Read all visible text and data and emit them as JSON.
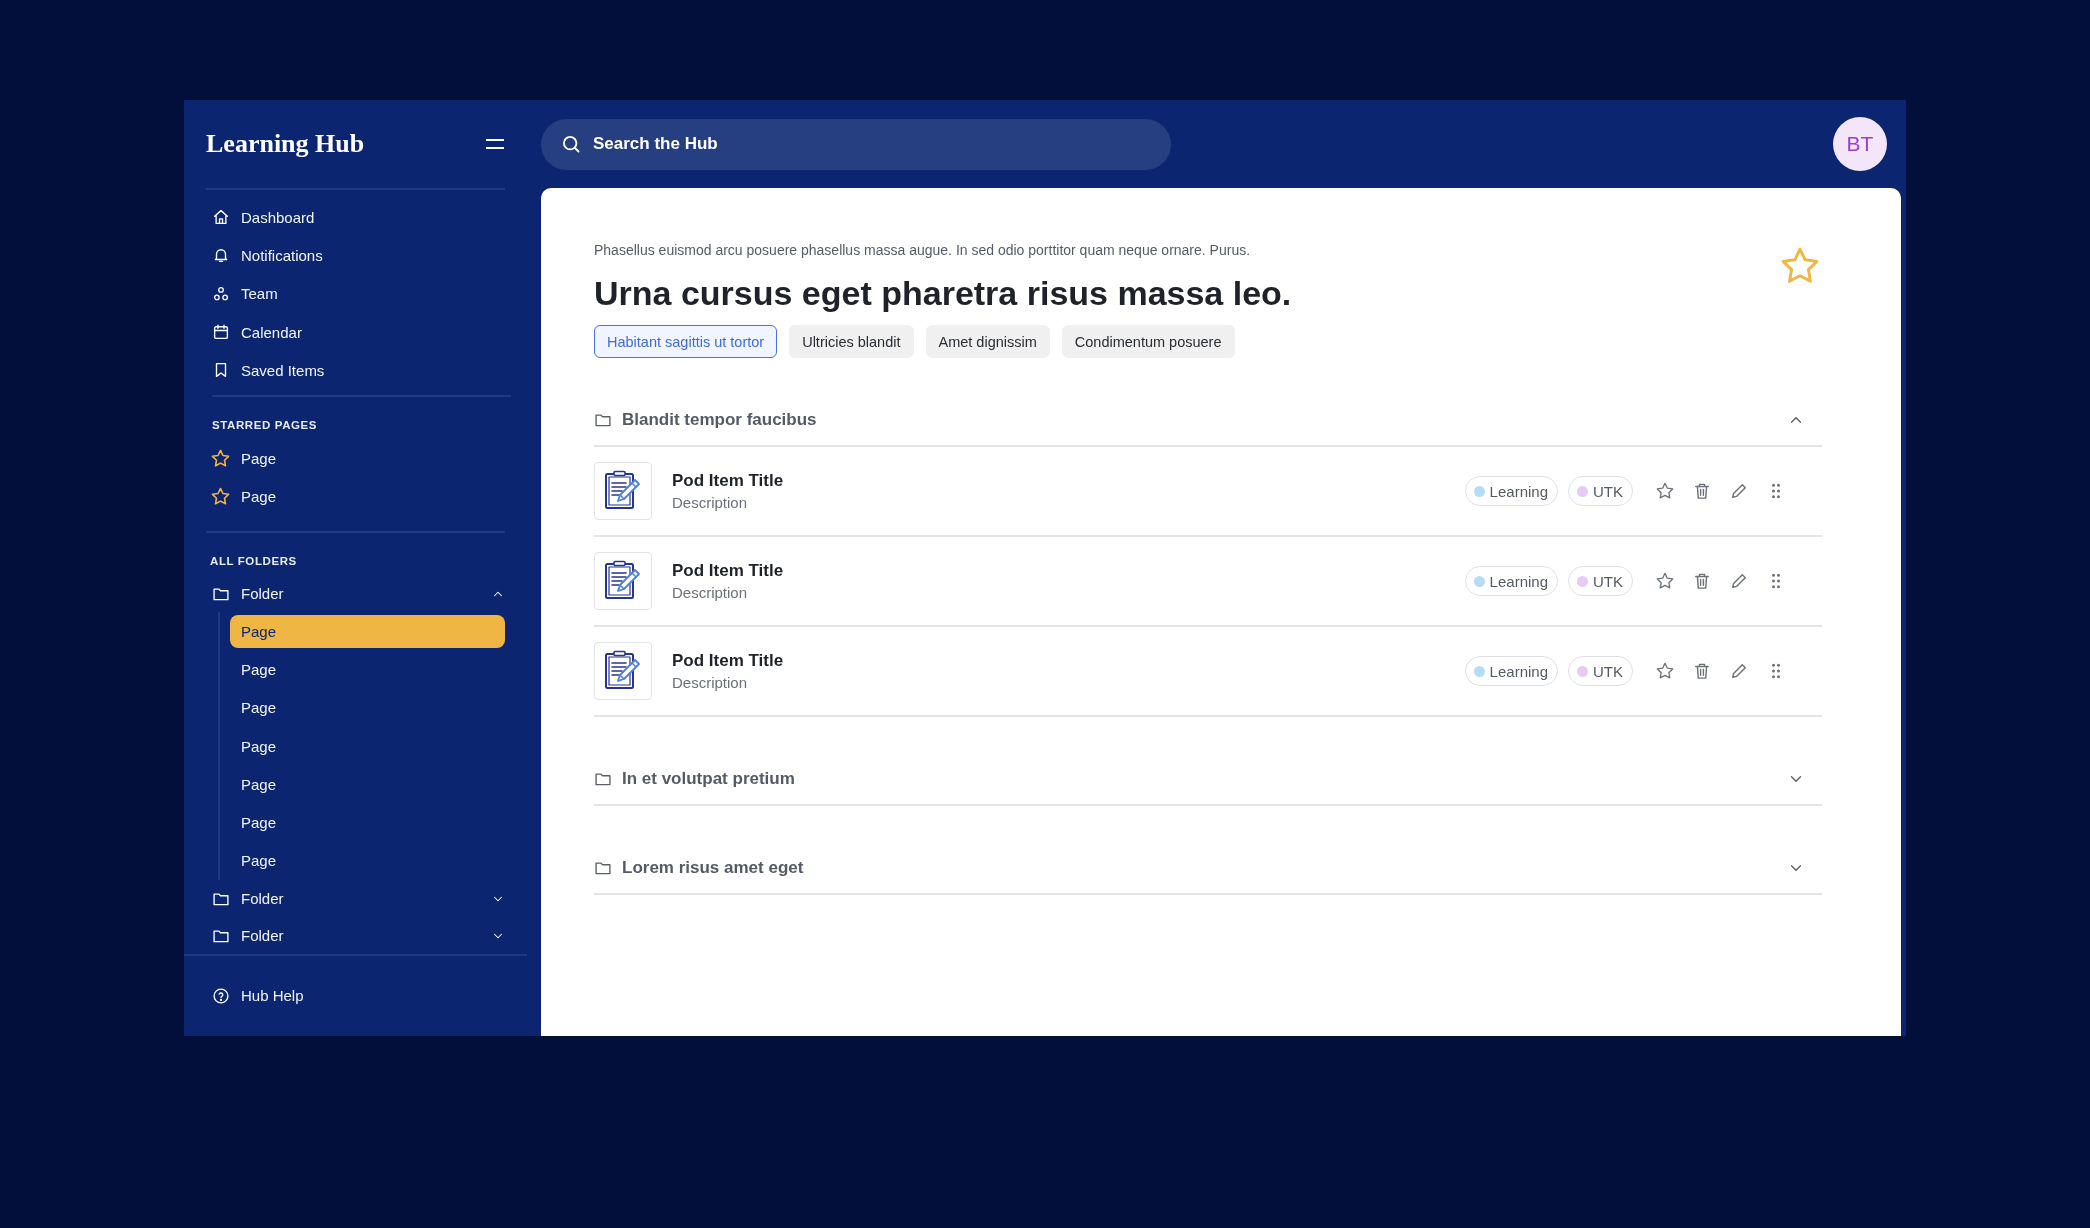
{
  "sidebar": {
    "logo": "Learning Hub",
    "nav": [
      {
        "label": "Dashboard",
        "kind": "home"
      },
      {
        "label": "Notifications",
        "kind": "bell"
      },
      {
        "label": "Team",
        "kind": "team"
      },
      {
        "label": "Calendar",
        "kind": "calendar"
      },
      {
        "label": "Saved Items",
        "kind": "bookmark"
      }
    ],
    "starred": {
      "heading": "STARRED PAGES",
      "items": [
        {
          "label": "Page"
        },
        {
          "label": "Page"
        }
      ]
    },
    "folders": {
      "heading": "ALL FOLDERS",
      "items": [
        {
          "label": "Folder",
          "expanded": true,
          "children": [
            {
              "label": "Page",
              "selected": true
            },
            {
              "label": "Page",
              "selected": false
            },
            {
              "label": "Page",
              "selected": false
            },
            {
              "label": "Page",
              "selected": false
            },
            {
              "label": "Page",
              "selected": false
            },
            {
              "label": "Page",
              "selected": false
            },
            {
              "label": "Page",
              "selected": false
            }
          ]
        },
        {
          "label": "Folder",
          "expanded": false
        },
        {
          "label": "Folder",
          "expanded": false
        }
      ]
    },
    "help": "Hub Help"
  },
  "search": {
    "placeholder": "Search the Hub"
  },
  "avatar": "BT",
  "page": {
    "subtitle": "Phasellus euismod arcu posuere phasellus massa augue. In sed odio porttitor quam neque ornare. Purus.",
    "title": "Urna cursus eget pharetra risus massa leo.",
    "starred": true,
    "tags": [
      {
        "label": "Habitant sagittis ut tortor",
        "selected": true
      },
      {
        "label": "Ultricies blandit",
        "selected": false
      },
      {
        "label": "Amet dignissim",
        "selected": false
      },
      {
        "label": "Condimentum posuere",
        "selected": false
      }
    ],
    "sections": [
      {
        "title": "Blandit tempor faucibus",
        "expanded": true,
        "items": [
          {
            "title": "Pod Item Title",
            "description": "Description",
            "starred": false,
            "tags": [
              {
                "label": "Learning",
                "color": "#b5dcf7"
              },
              {
                "label": "UTK",
                "color": "#e6ccf2"
              }
            ]
          },
          {
            "title": "Pod Item Title",
            "description": "Description",
            "starred": false,
            "tags": [
              {
                "label": "Learning",
                "color": "#b5dcf7"
              },
              {
                "label": "UTK",
                "color": "#e6ccf2"
              }
            ]
          },
          {
            "title": "Pod Item Title",
            "description": "Description",
            "starred": false,
            "tags": [
              {
                "label": "Learning",
                "color": "#b5dcf7"
              },
              {
                "label": "UTK",
                "color": "#e6ccf2"
              }
            ]
          }
        ]
      },
      {
        "title": "In et volutpat pretium",
        "expanded": false
      },
      {
        "title": "Lorem risus amet eget",
        "expanded": false
      }
    ]
  }
}
